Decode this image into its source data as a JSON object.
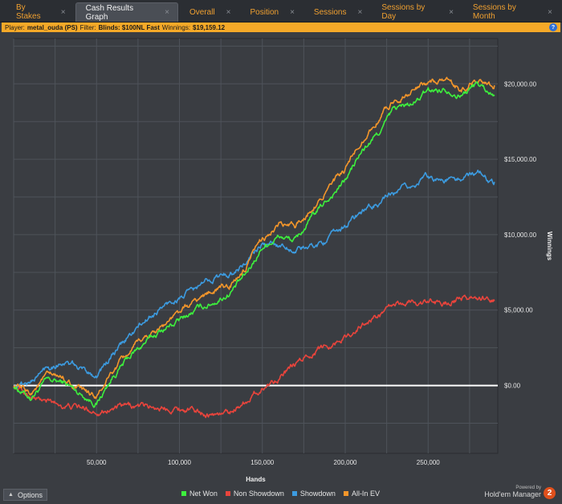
{
  "tabs": [
    {
      "label": "By Stakes",
      "active": false
    },
    {
      "label": "Cash Results Graph",
      "active": true
    },
    {
      "label": "Overall",
      "active": false
    },
    {
      "label": "Position",
      "active": false
    },
    {
      "label": "Sessions",
      "active": false
    },
    {
      "label": "Sessions by Day",
      "active": false
    },
    {
      "label": "Sessions by Month",
      "active": false
    }
  ],
  "filter": {
    "player_label": "Player:",
    "player_value": "metal_ouda (PS)",
    "filter_label": "Filter:",
    "filter_value": "Blinds: $100NL Fast",
    "winnings_label": "Winnings:",
    "winnings_value": "$19,159.12",
    "help_icon": "?"
  },
  "options_label": "Options",
  "brand": {
    "powered": "Powered by",
    "name": "Hold'em Manager",
    "logo": "2"
  },
  "colors": {
    "net_won": "#3df03d",
    "non_showdown": "#e8443c",
    "showdown": "#3c9be0",
    "all_in_ev": "#f5962a",
    "zero_line": "#ffffff",
    "grid": "#4e535a",
    "plot_bg": "#3a3d42"
  },
  "chart_data": {
    "type": "line",
    "title": "",
    "xlabel": "Hands",
    "ylabel": "Winnings",
    "xlim": [
      0,
      292000
    ],
    "ylim": [
      -4500,
      23000
    ],
    "x_ticks": [
      {
        "value": 50000,
        "label": "50,000"
      },
      {
        "value": 100000,
        "label": "100,000"
      },
      {
        "value": 150000,
        "label": "150,000"
      },
      {
        "value": 200000,
        "label": "200,000"
      },
      {
        "value": 250000,
        "label": "250,000"
      }
    ],
    "y_ticks": [
      {
        "value": 0,
        "label": "$0.00"
      },
      {
        "value": 5000,
        "label": "$5,000.00"
      },
      {
        "value": 10000,
        "label": "$10,000.00"
      },
      {
        "value": 15000,
        "label": "$15,000.00"
      },
      {
        "value": 20000,
        "label": "$20,000.00"
      }
    ],
    "x": [
      0,
      10000,
      20000,
      30000,
      40000,
      50000,
      60000,
      70000,
      80000,
      90000,
      100000,
      110000,
      120000,
      130000,
      140000,
      150000,
      160000,
      170000,
      180000,
      190000,
      200000,
      210000,
      220000,
      230000,
      240000,
      250000,
      260000,
      270000,
      280000,
      290000
    ],
    "series": [
      {
        "name": "Net Won",
        "color_key": "net_won",
        "values": [
          0,
          -800,
          300,
          200,
          -500,
          -1200,
          600,
          1900,
          2900,
          3700,
          4300,
          5000,
          5500,
          6100,
          7300,
          9200,
          9900,
          9600,
          11100,
          12400,
          13600,
          15500,
          16700,
          18400,
          18600,
          19500,
          19700,
          19300,
          20000,
          19200
        ]
      },
      {
        "name": "Non Showdown",
        "color_key": "non_showdown",
        "values": [
          0,
          -700,
          -1100,
          -1300,
          -1500,
          -1700,
          -1500,
          -1400,
          -1400,
          -1450,
          -1500,
          -1700,
          -1900,
          -1800,
          -1000,
          -200,
          600,
          1300,
          2200,
          2700,
          3200,
          4000,
          4600,
          5300,
          5600,
          5500,
          5500,
          5700,
          5800,
          5600
        ]
      },
      {
        "name": "Showdown",
        "color_key": "showdown",
        "values": [
          0,
          200,
          1200,
          1600,
          1100,
          700,
          2000,
          3300,
          4300,
          5200,
          5800,
          6400,
          7100,
          7400,
          8100,
          9300,
          9300,
          9000,
          9200,
          9700,
          10600,
          11500,
          12100,
          12700,
          13200,
          13900,
          13600,
          13700,
          14200,
          13500
        ]
      },
      {
        "name": "All-In EV",
        "color_key": "all_in_ev",
        "values": [
          0,
          -500,
          600,
          500,
          -300,
          -800,
          900,
          2200,
          3200,
          4000,
          4800,
          5600,
          6300,
          6600,
          7700,
          9700,
          10600,
          10500,
          11800,
          13100,
          14200,
          16300,
          17600,
          19000,
          19500,
          20100,
          20200,
          19600,
          20300,
          19900
        ]
      }
    ],
    "grid": true,
    "legend_position": "bottom"
  }
}
